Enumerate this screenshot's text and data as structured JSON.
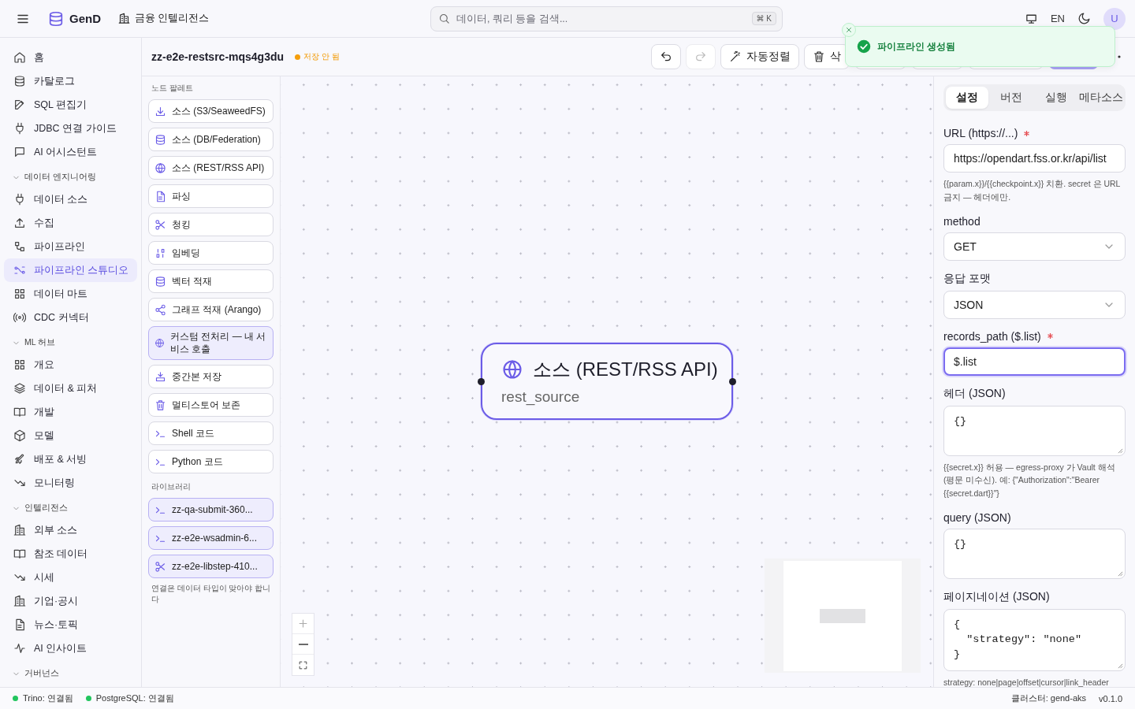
{
  "header": {
    "app_name": "GenD",
    "workspace": "금융 인텔리전스",
    "search": {
      "placeholder": "데이터, 쿼리 등을 검색...",
      "shortcut": "⌘ K"
    },
    "language": "EN",
    "avatar": "U"
  },
  "sidebar": {
    "items": [
      {
        "label": "홈",
        "selected": false
      },
      {
        "label": "카탈로그",
        "selected": false
      },
      {
        "label": "SQL 편집기",
        "selected": false
      },
      {
        "label": "JDBC 연결 가이드",
        "selected": false
      },
      {
        "label": "AI 어시스턴트",
        "selected": false
      }
    ],
    "sections": [
      {
        "title": "데이터 엔지니어링",
        "expanded": true,
        "items": [
          {
            "label": "데이터 소스",
            "selected": false
          },
          {
            "label": "수집",
            "selected": false
          },
          {
            "label": "파이프라인",
            "selected": false
          },
          {
            "label": "파이프라인 스튜디오",
            "selected": true
          },
          {
            "label": "데이터 마트",
            "selected": false
          },
          {
            "label": "CDC 커넥터",
            "selected": false
          }
        ]
      },
      {
        "title": "ML 허브",
        "expanded": true,
        "items": [
          {
            "label": "개요",
            "selected": false
          },
          {
            "label": "데이터 & 피처",
            "selected": false
          },
          {
            "label": "개발",
            "selected": false
          },
          {
            "label": "모델",
            "selected": false
          },
          {
            "label": "배포 & 서빙",
            "selected": false
          },
          {
            "label": "모니터링",
            "selected": false
          }
        ]
      },
      {
        "title": "인텔리전스",
        "expanded": true,
        "items": [
          {
            "label": "외부 소스",
            "selected": false
          },
          {
            "label": "참조 데이터",
            "selected": false
          },
          {
            "label": "시세",
            "selected": false
          },
          {
            "label": "기업·공시",
            "selected": false
          },
          {
            "label": "뉴스·토픽",
            "selected": false
          },
          {
            "label": "AI 인사이트",
            "selected": false
          }
        ]
      },
      {
        "title": "거버넌스",
        "expanded": true
      }
    ]
  },
  "toolbar": {
    "title": "zz-e2e-restsrc-mqs4g3du",
    "status": "저장 안 됨",
    "buttons": [
      {
        "kind": "undo",
        "disabled": false
      },
      {
        "kind": "redo",
        "disabled": true
      },
      {
        "kind": "autolayout",
        "label": "자동정렬",
        "disabled": false
      },
      {
        "kind": "delete",
        "label": "삭",
        "disabled": false
      },
      {
        "kind": "blank",
        "disabled": false
      },
      {
        "kind": "blank",
        "disabled": false
      },
      {
        "kind": "wide",
        "disabled": false
      },
      {
        "kind": "primary",
        "disabled": true
      },
      {
        "kind": "more"
      }
    ]
  },
  "palette": {
    "title": "노드 팔레트",
    "items": [
      {
        "label": "소스 (S3/SeaweedFS)",
        "kind": "builtin"
      },
      {
        "label": "소스 (DB/Federation)",
        "kind": "builtin"
      },
      {
        "label": "소스 (REST/RSS API)",
        "kind": "builtin"
      },
      {
        "label": "파싱",
        "kind": "builtin"
      },
      {
        "label": "청킹",
        "kind": "builtin"
      },
      {
        "label": "임베딩",
        "kind": "builtin"
      },
      {
        "label": "벡터 적재",
        "kind": "builtin"
      },
      {
        "label": "그래프 적재 (Arango)",
        "kind": "builtin"
      },
      {
        "label": "커스텀 전처리 — 내 서비스 호출",
        "kind": "custom"
      },
      {
        "label": "중간본 저장",
        "kind": "builtin"
      },
      {
        "label": "멀티스토어 보존",
        "kind": "builtin"
      },
      {
        "label": "Shell 코드",
        "kind": "builtin"
      },
      {
        "label": "Python 코드",
        "kind": "builtin"
      }
    ],
    "library_title": "라이브러리",
    "library": [
      {
        "label": "zz-qa-submit-360..."
      },
      {
        "label": "zz-e2e-wsadmin-6..."
      },
      {
        "label": "zz-e2e-libstep-410..."
      }
    ],
    "hint": "연결은 데이터 타입이 맞아야 합니다"
  },
  "canvas": {
    "node": {
      "title": "소스 (REST/RSS API)",
      "subtitle": "rest_source",
      "selected": true
    }
  },
  "panel": {
    "tabs": [
      {
        "label": "설정",
        "selected": true
      },
      {
        "label": "버전",
        "selected": false
      },
      {
        "label": "실행",
        "selected": false
      },
      {
        "label": "메타소스",
        "selected": false
      }
    ],
    "fields": [
      {
        "kind": "input",
        "label": "URL (https://...)",
        "required": true,
        "focused": false,
        "value": "https://opendart.fss.or.kr/api/list",
        "help": "{{param.x}}/{{checkpoint.x}} 치환. secret 은 URL 금지 — 헤더에만."
      },
      {
        "kind": "select",
        "label": "method",
        "required": false,
        "focused": false,
        "value": "GET"
      },
      {
        "kind": "select",
        "label": "응답 포맷",
        "required": false,
        "focused": false,
        "value": "JSON"
      },
      {
        "kind": "input",
        "label": "records_path ($.list)",
        "required": true,
        "focused": true,
        "value": "$.list"
      },
      {
        "kind": "textarea",
        "label": "헤더 (JSON)",
        "required": false,
        "focused": false,
        "value": "{}",
        "help": "{{secret.x}} 허용 — egress-proxy 가 Vault 해석 (평문 미수신). 예: {\"Authorization\":\"Bearer {{secret.dart}}\"}"
      },
      {
        "kind": "textarea",
        "label": "query (JSON)",
        "required": false,
        "focused": false,
        "value": "{}"
      },
      {
        "kind": "textarea",
        "label": "페이지네이션 (JSON)",
        "required": false,
        "focused": false,
        "value": "{\n  \"strategy\": \"none\"\n}",
        "help": "strategy: none|page|offset|cursor|link_header"
      }
    ]
  },
  "toast": {
    "message": "파이프라인 생성됨"
  },
  "status_bar": {
    "connections": [
      {
        "label": "Trino: 연결됨",
        "color": "#22c55e"
      },
      {
        "label": "PostgreSQL: 연결됨",
        "color": "#22c55e"
      }
    ],
    "cluster": "클러스터: gend-aks",
    "version": "v0.1.0"
  }
}
